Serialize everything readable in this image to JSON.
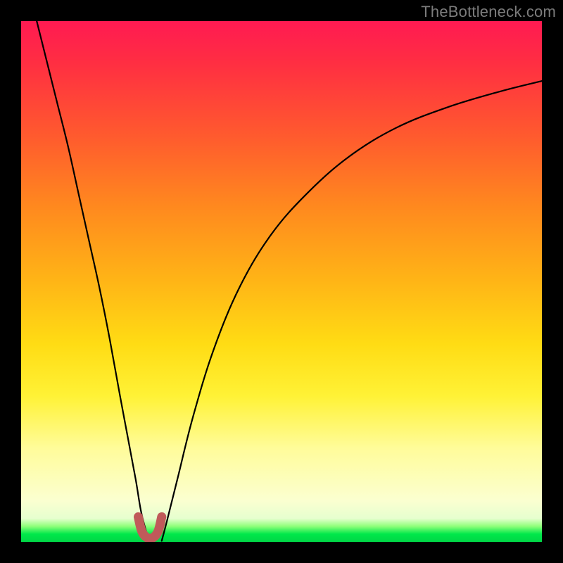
{
  "attribution": "TheBottleneck.com",
  "chart_data": {
    "type": "line",
    "title": "",
    "xlabel": "",
    "ylabel": "",
    "xlim": [
      0,
      100
    ],
    "ylim": [
      0,
      100
    ],
    "note": "Bottleneck-style chart: vertical color gradient from red (top, high bottleneck) through orange/yellow to green (bottom, no bottleneck). Two black curves descend steeply to a common minimum near x≈24 then the right branch rises asymptotically toward the top-right. A short red-brown U-shaped marker sits at the trough. Axis tick labels are not shown, so values are inferred on a 0–100 scale.",
    "series": [
      {
        "name": "left-branch",
        "x": [
          3,
          5,
          7,
          9,
          11,
          13,
          15,
          17,
          19,
          20.5,
          22,
          23,
          24,
          24.5
        ],
        "y": [
          100,
          92,
          84,
          76,
          67,
          58,
          49,
          39,
          28,
          20,
          12,
          6,
          2,
          0.2
        ]
      },
      {
        "name": "right-branch",
        "x": [
          27,
          28,
          30,
          33,
          37,
          42,
          48,
          55,
          63,
          72,
          82,
          92,
          100
        ],
        "y": [
          0.2,
          4,
          12,
          24,
          37,
          49,
          59,
          67,
          74,
          79.5,
          83.5,
          86.5,
          88.5
        ]
      },
      {
        "name": "trough-marker",
        "color": "#c05a5a",
        "x": [
          22.5,
          23.2,
          24.2,
          25.3,
          26.3,
          27.0
        ],
        "y": [
          4.8,
          2.0,
          0.8,
          0.8,
          2.0,
          4.8
        ]
      }
    ],
    "gradient_stops": [
      {
        "pos": 0.0,
        "color": "#ff1a52"
      },
      {
        "pos": 0.22,
        "color": "#ff5a2e"
      },
      {
        "pos": 0.5,
        "color": "#ffb516"
      },
      {
        "pos": 0.72,
        "color": "#fff236"
      },
      {
        "pos": 0.92,
        "color": "#fbffd0"
      },
      {
        "pos": 0.985,
        "color": "#00e84a"
      },
      {
        "pos": 1.0,
        "color": "#00d646"
      }
    ]
  }
}
